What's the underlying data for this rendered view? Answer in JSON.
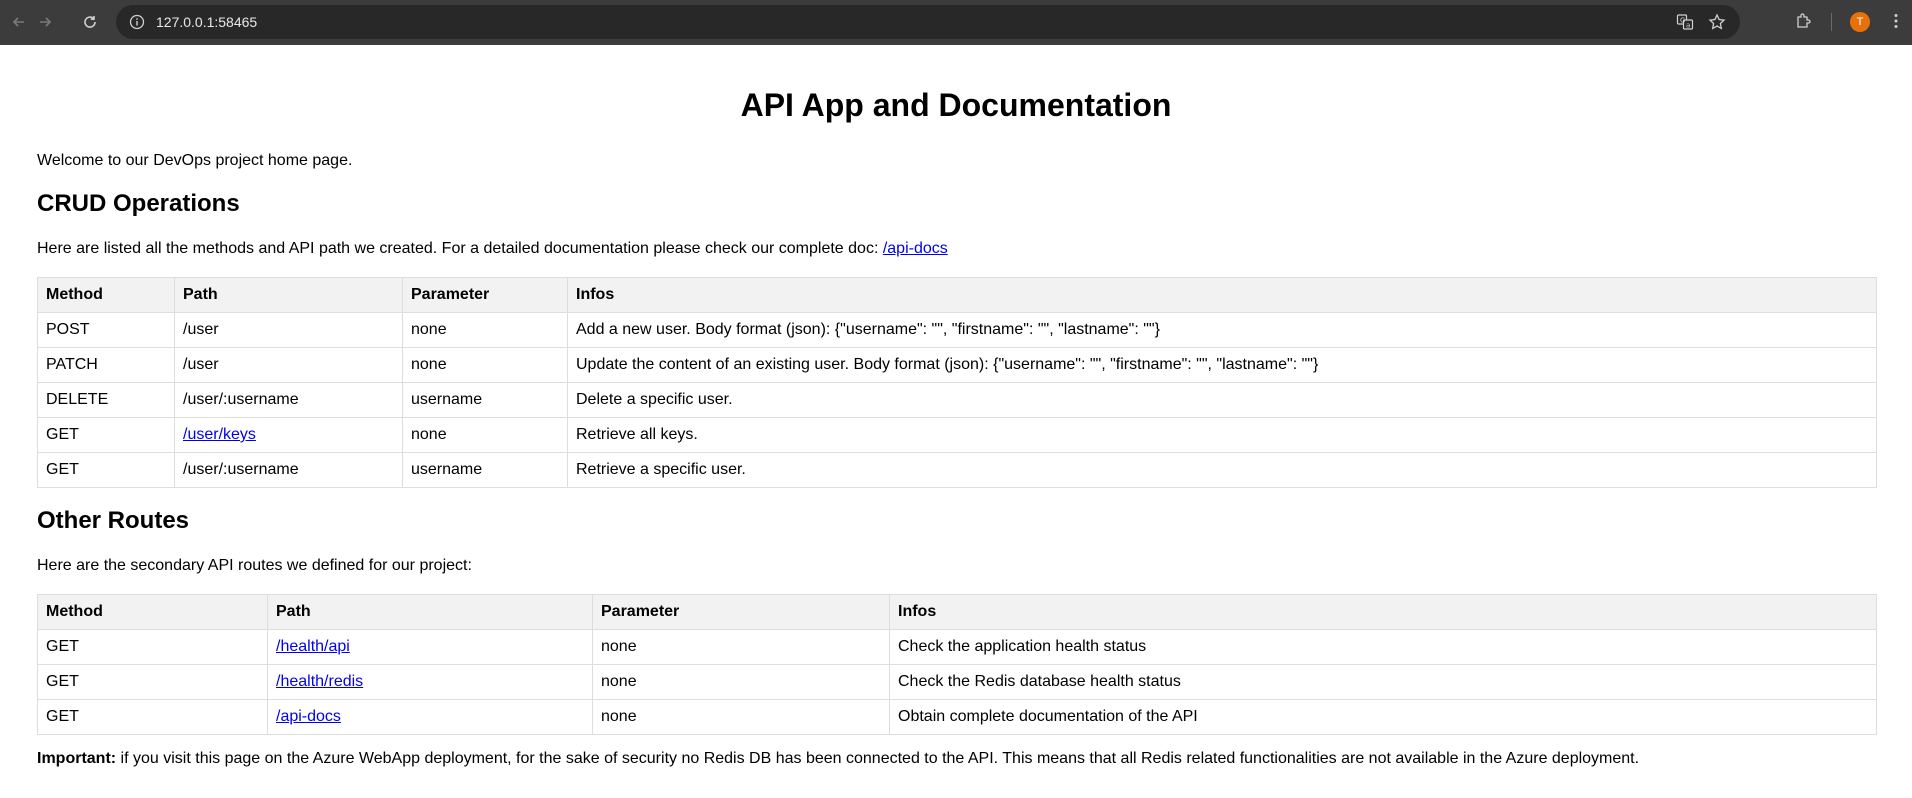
{
  "browser": {
    "url": "127.0.0.1:58465",
    "avatar_letter": "T",
    "accent_color": "#e8710a"
  },
  "page": {
    "title": "API App and Documentation",
    "welcome": "Welcome to our DevOps project home page."
  },
  "crud": {
    "heading": "CRUD Operations",
    "intro": "Here are listed all the methods and API path we created. For a detailed documentation please check our complete doc: ",
    "doc_link": "/api-docs",
    "headers": [
      "Method",
      "Path",
      "Parameter",
      "Infos"
    ],
    "rows": [
      {
        "method": "POST",
        "path": "/user",
        "path_is_link": false,
        "parameter": "none",
        "infos": "Add a new user. Body format (json): {\"username\": \"\", \"firstname\": \"\", \"lastname\": \"\"}"
      },
      {
        "method": "PATCH",
        "path": "/user",
        "path_is_link": false,
        "parameter": "none",
        "infos": "Update the content of an existing user. Body format (json): {\"username\": \"\", \"firstname\": \"\", \"lastname\": \"\"}"
      },
      {
        "method": "DELETE",
        "path": "/user/:username",
        "path_is_link": false,
        "parameter": "username",
        "infos": "Delete a specific user."
      },
      {
        "method": "GET",
        "path": "/user/keys",
        "path_is_link": true,
        "parameter": "none",
        "infos": "Retrieve all keys."
      },
      {
        "method": "GET",
        "path": "/user/:username",
        "path_is_link": false,
        "parameter": "username",
        "infos": "Retrieve a specific user."
      }
    ]
  },
  "other": {
    "heading": "Other Routes",
    "intro": "Here are the secondary API routes we defined for our project:",
    "headers": [
      "Method",
      "Path",
      "Parameter",
      "Infos"
    ],
    "rows": [
      {
        "method": "GET",
        "path": "/health/api",
        "path_is_link": true,
        "parameter": "none",
        "infos": "Check the application health status"
      },
      {
        "method": "GET",
        "path": "/health/redis",
        "path_is_link": true,
        "parameter": "none",
        "infos": "Check the Redis database health status"
      },
      {
        "method": "GET",
        "path": "/api-docs",
        "path_is_link": true,
        "parameter": "none",
        "infos": "Obtain complete documentation of the API"
      }
    ]
  },
  "important": {
    "label": "Important:",
    "text": " if you visit this page on the Azure WebApp deployment, for the sake of security no Redis DB has been connected to the API. This means that all Redis related functionalities are not available in the Azure deployment."
  }
}
